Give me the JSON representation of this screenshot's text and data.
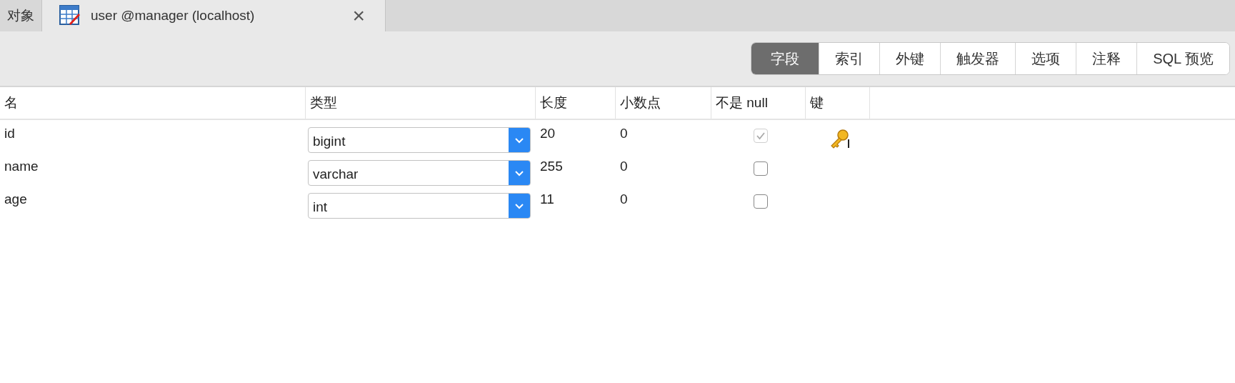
{
  "tabs": [
    {
      "label": "对象",
      "selected": false,
      "kind": "plain"
    },
    {
      "label": "user @manager (localhost)",
      "selected": true,
      "kind": "table",
      "close": "×"
    }
  ],
  "segments": [
    {
      "label": "字段",
      "selected": true
    },
    {
      "label": "索引",
      "selected": false
    },
    {
      "label": "外键",
      "selected": false
    },
    {
      "label": "触发器",
      "selected": false
    },
    {
      "label": "选项",
      "selected": false
    },
    {
      "label": "注释",
      "selected": false
    },
    {
      "label": "SQL 预览",
      "selected": false
    }
  ],
  "table": {
    "columns": [
      "名",
      "类型",
      "长度",
      "小数点",
      "不是 null",
      "键"
    ],
    "rows": [
      {
        "name": "id",
        "type": "bigint",
        "length": "20",
        "decimals": "0",
        "not_null": true,
        "not_null_disabled": true,
        "primary_key": true
      },
      {
        "name": "name",
        "type": "varchar",
        "length": "255",
        "decimals": "0",
        "not_null": false,
        "not_null_disabled": false,
        "primary_key": false
      },
      {
        "name": "age",
        "type": "int",
        "length": "11",
        "decimals": "0",
        "not_null": false,
        "not_null_disabled": false,
        "primary_key": false
      }
    ]
  }
}
